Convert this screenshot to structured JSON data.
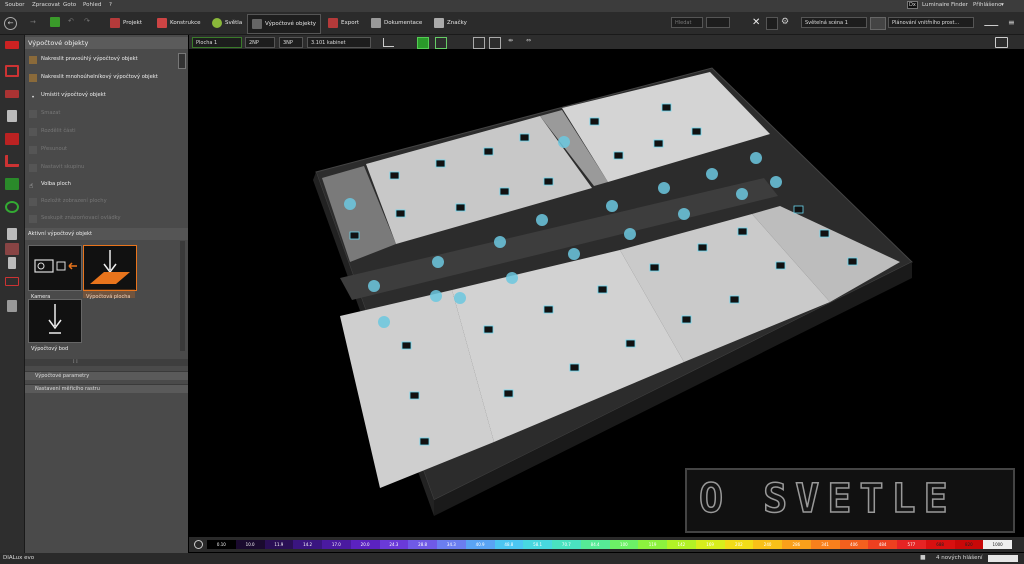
{
  "menu": {
    "items": [
      "Soubor",
      "Zpracovat",
      "Goto",
      "Pohled",
      "?"
    ],
    "luminaire_badge": "Dx",
    "luminaire_finder": "Luminaire Finder",
    "login": "Přihlášeno"
  },
  "toolbar": {
    "tabs": [
      "Projekt",
      "Konstrukce",
      "Světla",
      "Výpočtové objekty",
      "Export",
      "Dokumentace",
      "Značky"
    ],
    "active_tab": "Výpočtové objekty",
    "search_placeholder": "Hledat",
    "scene_select": "Světelná scéna 1",
    "plan_select": "Plánování vnitřního prost..."
  },
  "panel": {
    "title": "Výpočtové objekty",
    "items": [
      {
        "label": "Nakreslit pravoúhlý výpočtový objekt",
        "enabled": true
      },
      {
        "label": "Nakreslit mnohoúhelníkový výpočtový objekt",
        "enabled": true
      },
      {
        "label": "Umístit výpočtový objekt",
        "enabled": true
      },
      {
        "label": "Smazat",
        "enabled": false
      },
      {
        "label": "Rozdělit části",
        "enabled": false
      },
      {
        "label": "Přesunout",
        "enabled": false
      },
      {
        "label": "Nastavit skupinu",
        "enabled": false
      },
      {
        "label": "Volba ploch",
        "enabled": true
      },
      {
        "label": "Rozložit zobrazení plochy",
        "enabled": false
      },
      {
        "label": "Seskupit znázorňovací ovládky",
        "enabled": false
      }
    ],
    "active_header": "Aktivní výpočtový objekt",
    "tiles": [
      "Kamera",
      "Výpočtová plocha",
      "Výpočtový bod"
    ],
    "sections": [
      "Výpočtové parametry",
      "Nastavení měřicího rastru"
    ]
  },
  "view": {
    "level_select": "Plocha 1",
    "floor_a": "2NP",
    "floor_b": "3NP",
    "room_select": "3.101 kabinet"
  },
  "legend": {
    "values": [
      "0.10",
      "10.0",
      "11.9",
      "14.2",
      "17.0",
      "20.0",
      "24.3",
      "28.8",
      "34.3",
      "40.9",
      "48.8",
      "58.1",
      "70.7",
      "84.4",
      "100",
      "119",
      "142",
      "169",
      "202",
      "240",
      "286",
      "341",
      "406",
      "484",
      "577",
      "688",
      "820",
      "1000"
    ],
    "colors": [
      "#000000",
      "#1a0a2e",
      "#2a0f55",
      "#3a1580",
      "#4a1aa0",
      "#5b22c0",
      "#6a3ad8",
      "#6f5ae6",
      "#6b7ef0",
      "#5aa4f4",
      "#4cc6f2",
      "#48d8e0",
      "#4ae2c0",
      "#56ea96",
      "#6cf066",
      "#8cf23e",
      "#b2f226",
      "#d8ee1c",
      "#f2dc18",
      "#f8c018",
      "#faa01a",
      "#f8801c",
      "#f4601e",
      "#ee4020",
      "#e62424",
      "#d81010",
      "#c80808",
      "#eeeeee"
    ]
  },
  "status": {
    "app_name": "DIALux evo",
    "messages": "4 nových hlášení"
  },
  "watermark": "O SVETLE"
}
